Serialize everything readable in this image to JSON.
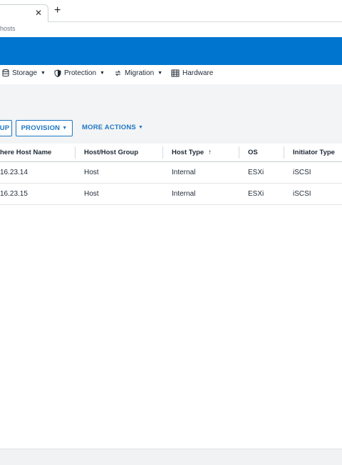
{
  "browser": {
    "new_tab_icon": "plus-icon",
    "close_tab_icon": "close-icon",
    "url_fragment": "hosts"
  },
  "colors": {
    "header_blue": "#0075cf",
    "accent": "#1f77c4",
    "band_grey": "#f3f4f5"
  },
  "nav": {
    "items": [
      {
        "label": "Storage",
        "icon": "database-icon",
        "has_dropdown": true
      },
      {
        "label": "Protection",
        "icon": "shield-icon",
        "has_dropdown": true
      },
      {
        "label": "Migration",
        "icon": "migration-icon",
        "has_dropdown": true
      },
      {
        "label": "Hardware",
        "icon": "hardware-icon",
        "has_dropdown": false
      }
    ]
  },
  "actions": {
    "partial_button_label": "UP",
    "provision_label": "PROVISION",
    "more_actions_label": "MORE ACTIONS"
  },
  "table": {
    "columns": [
      {
        "label": "here Host Name"
      },
      {
        "label": "Host/Host Group"
      },
      {
        "label": "Host Type",
        "sort": "ascending"
      },
      {
        "label": "OS"
      },
      {
        "label": "Initiator Type"
      }
    ],
    "sort_icon": "↑",
    "rows": [
      [
        "16.23.14",
        "Host",
        "Internal",
        "ESXi",
        "iSCSI"
      ],
      [
        "16.23.15",
        "Host",
        "Internal",
        "ESXi",
        "iSCSI"
      ]
    ]
  }
}
